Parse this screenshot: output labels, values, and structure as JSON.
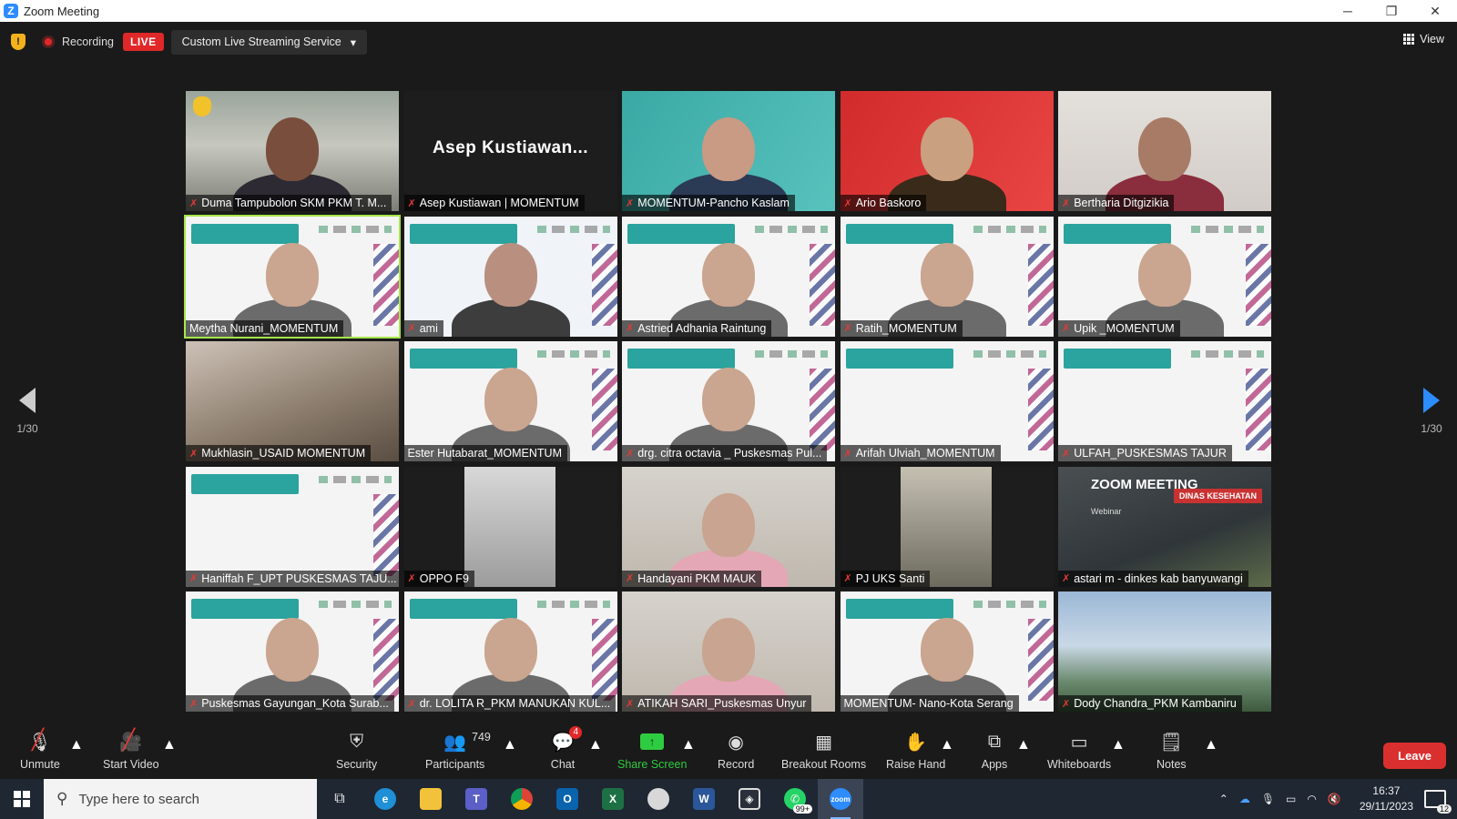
{
  "window": {
    "title": "Zoom Meeting",
    "minimize": "─",
    "restore": "❐",
    "close": "✕"
  },
  "topbar": {
    "recording_label": "Recording",
    "live_label": "LIVE",
    "stream_service": "Custom Live Streaming Service",
    "view_label": "View"
  },
  "pagination": {
    "left_label": "1/30",
    "right_label": "1/30"
  },
  "participants_grid": [
    {
      "name": "Duma Tampubolon SKM PKM T. M...",
      "muted": true,
      "raised_hand": true,
      "style": "photo-indoor"
    },
    {
      "name": "Asep Kustiawan | MOMENTUM",
      "muted": true,
      "display_name": "Asep  Kustiawan...",
      "style": "no-video"
    },
    {
      "name": "MOMENTUM-Pancho Kaslam",
      "muted": true,
      "style": "teal-bg"
    },
    {
      "name": "Ario Baskoro",
      "muted": true,
      "style": "red-bg"
    },
    {
      "name": "Bertharia Ditgizikia",
      "muted": true,
      "style": "photo-light"
    },
    {
      "name": "Meytha Nurani_MOMENTUM",
      "muted": false,
      "active_speaker": true,
      "style": "slide"
    },
    {
      "name": "ami",
      "muted": true,
      "style": "slide-blue"
    },
    {
      "name": "Astried Adhania Raintung",
      "muted": true,
      "style": "slide"
    },
    {
      "name": "Ratih_MOMENTUM",
      "muted": true,
      "style": "slide"
    },
    {
      "name": "Upik _MOMENTUM",
      "muted": true,
      "style": "slide"
    },
    {
      "name": "Mukhlasin_USAID MOMENTUM",
      "muted": true,
      "style": "photo-office"
    },
    {
      "name": "Ester Hutabarat_MOMENTUM",
      "muted": false,
      "style": "slide"
    },
    {
      "name": "drg. citra octavia _ Puskesmas Pul...",
      "muted": true,
      "style": "slide"
    },
    {
      "name": "Arifah Ulviah_MOMENTUM",
      "muted": true,
      "style": "slide-empty"
    },
    {
      "name": "ULFAH_PUSKESMAS TAJUR",
      "muted": true,
      "style": "slide-empty"
    },
    {
      "name": "Haniffah F_UPT PUSKESMAS TAJU...",
      "muted": true,
      "style": "slide-empty"
    },
    {
      "name": "OPPO F9",
      "muted": true,
      "style": "portrait-dark"
    },
    {
      "name": "Handayani PKM MAUK",
      "muted": true,
      "style": "photo-office-light"
    },
    {
      "name": "PJ UKS Santi",
      "muted": true,
      "style": "portrait-room"
    },
    {
      "name": "astari m - dinkes kab banyuwangi",
      "muted": true,
      "style": "zoom-banner",
      "banner_title": "ZOOM MEETING",
      "banner_sub": "Webinar",
      "banner_sign": "DINAS KESEHATAN"
    },
    {
      "name": "Puskesmas Gayungan_Kota Surab...",
      "muted": true,
      "style": "slide"
    },
    {
      "name": "dr. LOLITA R_PKM MANUKAN KUL...",
      "muted": true,
      "style": "slide"
    },
    {
      "name": "ATIKAH SARI_Puskesmas Unyur",
      "muted": true,
      "style": "photo-office-light"
    },
    {
      "name": "MOMENTUM- Nano-Kota Serang",
      "muted": false,
      "style": "slide"
    },
    {
      "name": "Dody Chandra_PKM Kambaniru",
      "muted": true,
      "style": "landscape"
    }
  ],
  "controls": {
    "unmute": "Unmute",
    "start_video": "Start Video",
    "security": "Security",
    "participants": "Participants",
    "participants_count": "749",
    "chat": "Chat",
    "chat_badge": "4",
    "share_screen": "Share Screen",
    "record": "Record",
    "breakout_rooms": "Breakout Rooms",
    "raise_hand": "Raise Hand",
    "apps": "Apps",
    "whiteboards": "Whiteboards",
    "notes": "Notes",
    "leave": "Leave"
  },
  "taskbar": {
    "search_placeholder": "Type here to search",
    "whatsapp_badge": "99+",
    "time": "16:37",
    "date": "29/11/2023",
    "notifications_count": "12"
  }
}
